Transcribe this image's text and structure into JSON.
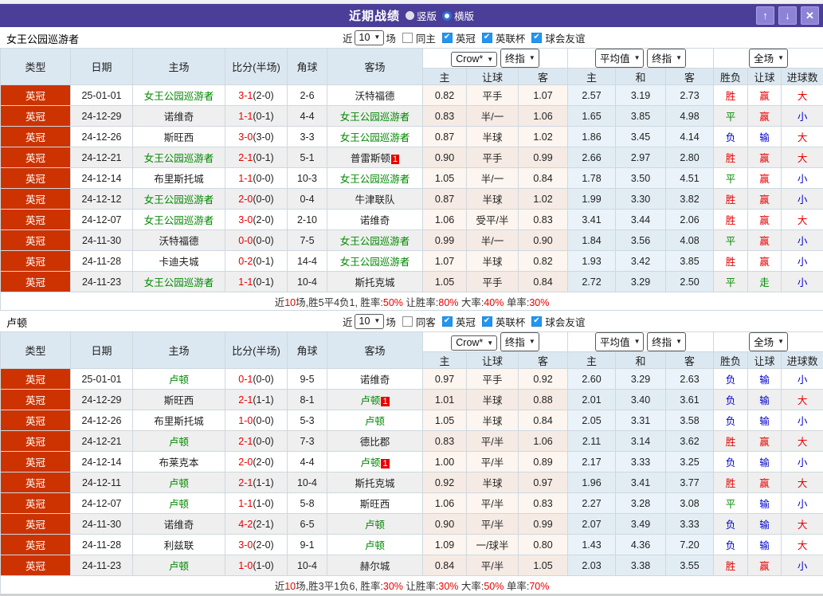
{
  "header": {
    "title": "近期战绩",
    "radio_vertical": "竖版",
    "radio_horizontal": "横版",
    "up_icon": "↑",
    "down_icon": "↓",
    "close_icon": "✕"
  },
  "filter": {
    "near_label": "近",
    "count": "10",
    "games_label": "场",
    "leagues": [
      "英冠",
      "英联杯",
      "球会友谊"
    ]
  },
  "columns": {
    "fixed": [
      "类型",
      "日期",
      "主场",
      "比分(半场)",
      "角球",
      "客场"
    ],
    "crow_source": "Crow*",
    "crow_kind": "终指",
    "avg_source": "平均值",
    "avg_kind": "终指",
    "full_source": "全场",
    "sub": [
      "主",
      "让球",
      "客",
      "主",
      "和",
      "客",
      "胜负",
      "让球",
      "进球数"
    ]
  },
  "colors": {
    "titlebar_purple": "#4b3e98",
    "type_red": "#cc3300",
    "win_red": "#e80000",
    "lose_blue": "#0000cd",
    "draw_green": "#008800",
    "team_green": "#008800"
  },
  "tables": [
    {
      "team": "女王公园巡游者",
      "same_label": "同主",
      "rows": [
        {
          "type": "英冠",
          "date": "25-01-01",
          "home": "女王公园巡游者",
          "homeT": true,
          "score": "3-1",
          "half": "(2-0)",
          "corner": "2-6",
          "away": "沃特福德",
          "awayT": false,
          "badge": "",
          "crow": [
            "0.82",
            "平手",
            "1.07"
          ],
          "avg": [
            "2.57",
            "3.19",
            "2.73"
          ],
          "res": [
            [
              "胜",
              "w"
            ],
            [
              "赢",
              "w"
            ],
            [
              "大",
              "w"
            ]
          ]
        },
        {
          "type": "英冠",
          "date": "24-12-29",
          "home": "诺维奇",
          "homeT": false,
          "score": "1-1",
          "half": "(0-1)",
          "corner": "4-4",
          "away": "女王公园巡游者",
          "awayT": true,
          "badge": "",
          "crow": [
            "0.83",
            "半/一",
            "1.06"
          ],
          "avg": [
            "1.65",
            "3.85",
            "4.98"
          ],
          "res": [
            [
              "平",
              "d"
            ],
            [
              "赢",
              "w"
            ],
            [
              "小",
              "l"
            ]
          ]
        },
        {
          "type": "英冠",
          "date": "24-12-26",
          "home": "斯旺西",
          "homeT": false,
          "score": "3-0",
          "half": "(3-0)",
          "corner": "3-3",
          "away": "女王公园巡游者",
          "awayT": true,
          "badge": "",
          "crow": [
            "0.87",
            "半球",
            "1.02"
          ],
          "avg": [
            "1.86",
            "3.45",
            "4.14"
          ],
          "res": [
            [
              "负",
              "l"
            ],
            [
              "输",
              "l"
            ],
            [
              "大",
              "w"
            ]
          ]
        },
        {
          "type": "英冠",
          "date": "24-12-21",
          "home": "女王公园巡游者",
          "homeT": true,
          "score": "2-1",
          "half": "(0-1)",
          "corner": "5-1",
          "away": "普雷斯顿",
          "awayT": false,
          "badge": "1",
          "crow": [
            "0.90",
            "平手",
            "0.99"
          ],
          "avg": [
            "2.66",
            "2.97",
            "2.80"
          ],
          "res": [
            [
              "胜",
              "w"
            ],
            [
              "赢",
              "w"
            ],
            [
              "大",
              "w"
            ]
          ]
        },
        {
          "type": "英冠",
          "date": "24-12-14",
          "home": "布里斯托城",
          "homeT": false,
          "score": "1-1",
          "half": "(0-0)",
          "corner": "10-3",
          "away": "女王公园巡游者",
          "awayT": true,
          "badge": "",
          "crow": [
            "1.05",
            "半/一",
            "0.84"
          ],
          "avg": [
            "1.78",
            "3.50",
            "4.51"
          ],
          "res": [
            [
              "平",
              "d"
            ],
            [
              "赢",
              "w"
            ],
            [
              "小",
              "l"
            ]
          ]
        },
        {
          "type": "英冠",
          "date": "24-12-12",
          "home": "女王公园巡游者",
          "homeT": true,
          "score": "2-0",
          "half": "(0-0)",
          "corner": "0-4",
          "away": "牛津联队",
          "awayT": false,
          "badge": "",
          "crow": [
            "0.87",
            "半球",
            "1.02"
          ],
          "avg": [
            "1.99",
            "3.30",
            "3.82"
          ],
          "res": [
            [
              "胜",
              "w"
            ],
            [
              "赢",
              "w"
            ],
            [
              "小",
              "l"
            ]
          ]
        },
        {
          "type": "英冠",
          "date": "24-12-07",
          "home": "女王公园巡游者",
          "homeT": true,
          "score": "3-0",
          "half": "(2-0)",
          "corner": "2-10",
          "away": "诺维奇",
          "awayT": false,
          "badge": "",
          "crow": [
            "1.06",
            "受平/半",
            "0.83"
          ],
          "avg": [
            "3.41",
            "3.44",
            "2.06"
          ],
          "res": [
            [
              "胜",
              "w"
            ],
            [
              "赢",
              "w"
            ],
            [
              "大",
              "w"
            ]
          ]
        },
        {
          "type": "英冠",
          "date": "24-11-30",
          "home": "沃特福德",
          "homeT": false,
          "score": "0-0",
          "half": "(0-0)",
          "corner": "7-5",
          "away": "女王公园巡游者",
          "awayT": true,
          "badge": "",
          "crow": [
            "0.99",
            "半/一",
            "0.90"
          ],
          "avg": [
            "1.84",
            "3.56",
            "4.08"
          ],
          "res": [
            [
              "平",
              "d"
            ],
            [
              "赢",
              "w"
            ],
            [
              "小",
              "l"
            ]
          ]
        },
        {
          "type": "英冠",
          "date": "24-11-28",
          "home": "卡迪夫城",
          "homeT": false,
          "score": "0-2",
          "half": "(0-1)",
          "corner": "14-4",
          "away": "女王公园巡游者",
          "awayT": true,
          "badge": "",
          "crow": [
            "1.07",
            "半球",
            "0.82"
          ],
          "avg": [
            "1.93",
            "3.42",
            "3.85"
          ],
          "res": [
            [
              "胜",
              "w"
            ],
            [
              "赢",
              "w"
            ],
            [
              "小",
              "l"
            ]
          ]
        },
        {
          "type": "英冠",
          "date": "24-11-23",
          "home": "女王公园巡游者",
          "homeT": true,
          "score": "1-1",
          "half": "(0-1)",
          "corner": "10-4",
          "away": "斯托克城",
          "awayT": false,
          "badge": "",
          "crow": [
            "1.05",
            "平手",
            "0.84"
          ],
          "avg": [
            "2.72",
            "3.29",
            "2.50"
          ],
          "res": [
            [
              "平",
              "d"
            ],
            [
              "走",
              "d"
            ],
            [
              "小",
              "l"
            ]
          ]
        }
      ],
      "summary": [
        {
          "t": "近"
        },
        {
          "t": "10",
          "red": true
        },
        {
          "t": "场,胜5平4负1, 胜率:"
        },
        {
          "t": "50%",
          "red": true
        },
        {
          "t": " 让胜率:"
        },
        {
          "t": "80%",
          "red": true
        },
        {
          "t": " 大率:"
        },
        {
          "t": "40%",
          "red": true
        },
        {
          "t": " 单率:"
        },
        {
          "t": "30%",
          "red": true
        }
      ]
    },
    {
      "team": "卢顿",
      "same_label": "同客",
      "rows": [
        {
          "type": "英冠",
          "date": "25-01-01",
          "home": "卢顿",
          "homeT": true,
          "score": "0-1",
          "half": "(0-0)",
          "corner": "9-5",
          "away": "诺维奇",
          "awayT": false,
          "badge": "",
          "crow": [
            "0.97",
            "平手",
            "0.92"
          ],
          "avg": [
            "2.60",
            "3.29",
            "2.63"
          ],
          "res": [
            [
              "负",
              "l"
            ],
            [
              "输",
              "l"
            ],
            [
              "小",
              "l"
            ]
          ]
        },
        {
          "type": "英冠",
          "date": "24-12-29",
          "home": "斯旺西",
          "homeT": false,
          "score": "2-1",
          "half": "(1-1)",
          "corner": "8-1",
          "away": "卢顿",
          "awayT": true,
          "badge": "1",
          "crow": [
            "1.01",
            "半球",
            "0.88"
          ],
          "avg": [
            "2.01",
            "3.40",
            "3.61"
          ],
          "res": [
            [
              "负",
              "l"
            ],
            [
              "输",
              "l"
            ],
            [
              "大",
              "w"
            ]
          ]
        },
        {
          "type": "英冠",
          "date": "24-12-26",
          "home": "布里斯托城",
          "homeT": false,
          "score": "1-0",
          "half": "(0-0)",
          "corner": "5-3",
          "away": "卢顿",
          "awayT": true,
          "badge": "",
          "crow": [
            "1.05",
            "半球",
            "0.84"
          ],
          "avg": [
            "2.05",
            "3.31",
            "3.58"
          ],
          "res": [
            [
              "负",
              "l"
            ],
            [
              "输",
              "l"
            ],
            [
              "小",
              "l"
            ]
          ]
        },
        {
          "type": "英冠",
          "date": "24-12-21",
          "home": "卢顿",
          "homeT": true,
          "score": "2-1",
          "half": "(0-0)",
          "corner": "7-3",
          "away": "德比郡",
          "awayT": false,
          "badge": "",
          "crow": [
            "0.83",
            "平/半",
            "1.06"
          ],
          "avg": [
            "2.11",
            "3.14",
            "3.62"
          ],
          "res": [
            [
              "胜",
              "w"
            ],
            [
              "赢",
              "w"
            ],
            [
              "大",
              "w"
            ]
          ]
        },
        {
          "type": "英冠",
          "date": "24-12-14",
          "home": "布莱克本",
          "homeT": false,
          "score": "2-0",
          "half": "(2-0)",
          "corner": "4-4",
          "away": "卢顿",
          "awayT": true,
          "badge": "1",
          "crow": [
            "1.00",
            "平/半",
            "0.89"
          ],
          "avg": [
            "2.17",
            "3.33",
            "3.25"
          ],
          "res": [
            [
              "负",
              "l"
            ],
            [
              "输",
              "l"
            ],
            [
              "小",
              "l"
            ]
          ]
        },
        {
          "type": "英冠",
          "date": "24-12-11",
          "home": "卢顿",
          "homeT": true,
          "score": "2-1",
          "half": "(1-1)",
          "corner": "10-4",
          "away": "斯托克城",
          "awayT": false,
          "badge": "",
          "crow": [
            "0.92",
            "半球",
            "0.97"
          ],
          "avg": [
            "1.96",
            "3.41",
            "3.77"
          ],
          "res": [
            [
              "胜",
              "w"
            ],
            [
              "赢",
              "w"
            ],
            [
              "大",
              "w"
            ]
          ]
        },
        {
          "type": "英冠",
          "date": "24-12-07",
          "home": "卢顿",
          "homeT": true,
          "score": "1-1",
          "half": "(1-0)",
          "corner": "5-8",
          "away": "斯旺西",
          "awayT": false,
          "badge": "",
          "crow": [
            "1.06",
            "平/半",
            "0.83"
          ],
          "avg": [
            "2.27",
            "3.28",
            "3.08"
          ],
          "res": [
            [
              "平",
              "d"
            ],
            [
              "输",
              "l"
            ],
            [
              "小",
              "l"
            ]
          ]
        },
        {
          "type": "英冠",
          "date": "24-11-30",
          "home": "诺维奇",
          "homeT": false,
          "score": "4-2",
          "half": "(2-1)",
          "corner": "6-5",
          "away": "卢顿",
          "awayT": true,
          "badge": "",
          "crow": [
            "0.90",
            "平/半",
            "0.99"
          ],
          "avg": [
            "2.07",
            "3.49",
            "3.33"
          ],
          "res": [
            [
              "负",
              "l"
            ],
            [
              "输",
              "l"
            ],
            [
              "大",
              "w"
            ]
          ]
        },
        {
          "type": "英冠",
          "date": "24-11-28",
          "home": "利兹联",
          "homeT": false,
          "score": "3-0",
          "half": "(2-0)",
          "corner": "9-1",
          "away": "卢顿",
          "awayT": true,
          "badge": "",
          "crow": [
            "1.09",
            "一/球半",
            "0.80"
          ],
          "avg": [
            "1.43",
            "4.36",
            "7.20"
          ],
          "res": [
            [
              "负",
              "l"
            ],
            [
              "输",
              "l"
            ],
            [
              "大",
              "w"
            ]
          ]
        },
        {
          "type": "英冠",
          "date": "24-11-23",
          "home": "卢顿",
          "homeT": true,
          "score": "1-0",
          "half": "(1-0)",
          "corner": "10-4",
          "away": "赫尔城",
          "awayT": false,
          "badge": "",
          "crow": [
            "0.84",
            "平/半",
            "1.05"
          ],
          "avg": [
            "2.03",
            "3.38",
            "3.55"
          ],
          "res": [
            [
              "胜",
              "w"
            ],
            [
              "赢",
              "w"
            ],
            [
              "小",
              "l"
            ]
          ]
        }
      ],
      "summary": [
        {
          "t": "近"
        },
        {
          "t": "10",
          "red": true
        },
        {
          "t": "场,胜3平1负6, 胜率:"
        },
        {
          "t": "30%",
          "red": true
        },
        {
          "t": " 让胜率:"
        },
        {
          "t": "30%",
          "red": true
        },
        {
          "t": " 大率:"
        },
        {
          "t": "50%",
          "red": true
        },
        {
          "t": " 单率:"
        },
        {
          "t": "70%",
          "red": true
        }
      ]
    }
  ]
}
